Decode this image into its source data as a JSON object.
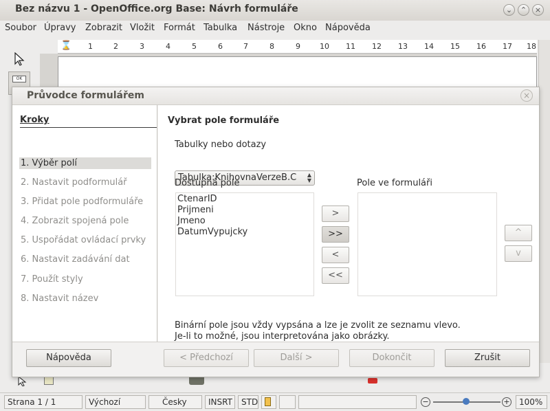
{
  "window": {
    "title": "Bez názvu 1 - OpenOffice.org Base: Návrh formuláře",
    "controls": [
      "⌄",
      "⌃",
      "×"
    ]
  },
  "menu": [
    "Soubor",
    "Úpravy",
    "Zobrazit",
    "Vložit",
    "Formát",
    "Tabulka",
    "Nástroje",
    "Okno",
    "Nápověda"
  ],
  "ruler": [
    "1",
    "2",
    "3",
    "4",
    "5",
    "6",
    "7",
    "8",
    "9",
    "10",
    "11",
    "12",
    "13",
    "14",
    "15",
    "16",
    "17",
    "18"
  ],
  "dialog": {
    "title": "Průvodce formulářem",
    "close": "×",
    "steps_header": "Kroky",
    "steps": [
      "1. Výběr polí",
      "2. Nastavit podformulář",
      "3. Přidat pole podformuláře",
      "4. Zobrazit spojená pole",
      "5. Uspořádat ovládací prvky",
      "6. Nastavit zadávání dat",
      "7. Použít styly",
      "8. Nastavit název"
    ],
    "active_step": 0,
    "heading": "Vybrat pole formuláře",
    "tables_label": "Tabulky nebo dotazy",
    "table_select_value": "Tabulka:KnihovnaVerzeB.C",
    "available_label": "Dostupná pole",
    "form_fields_label": "Pole ve formuláři",
    "available_fields": [
      "CtenarID",
      "Prijmeni",
      "Jmeno",
      "DatumVypujcky"
    ],
    "form_fields": [],
    "move_buttons": [
      ">",
      ">>",
      "<",
      "<<"
    ],
    "order_buttons": [
      "^",
      "v"
    ],
    "note_line1": "Binární pole jsou vždy vypsána a lze je zvolit ze seznamu vlevo.",
    "note_line2": "Je-li to možné, jsou interpretována jako obrázky.",
    "buttons": {
      "help": "Nápověda",
      "back": "< Předchozí",
      "next": "Další >",
      "finish": "Dokončit",
      "cancel": "Zrušit"
    }
  },
  "statusbar": {
    "page": "Strana 1 / 1",
    "style": "Výchozí",
    "language": "Česky",
    "insert_mode": "INSRT",
    "selection_mode": "STD",
    "zoom": "100%"
  }
}
